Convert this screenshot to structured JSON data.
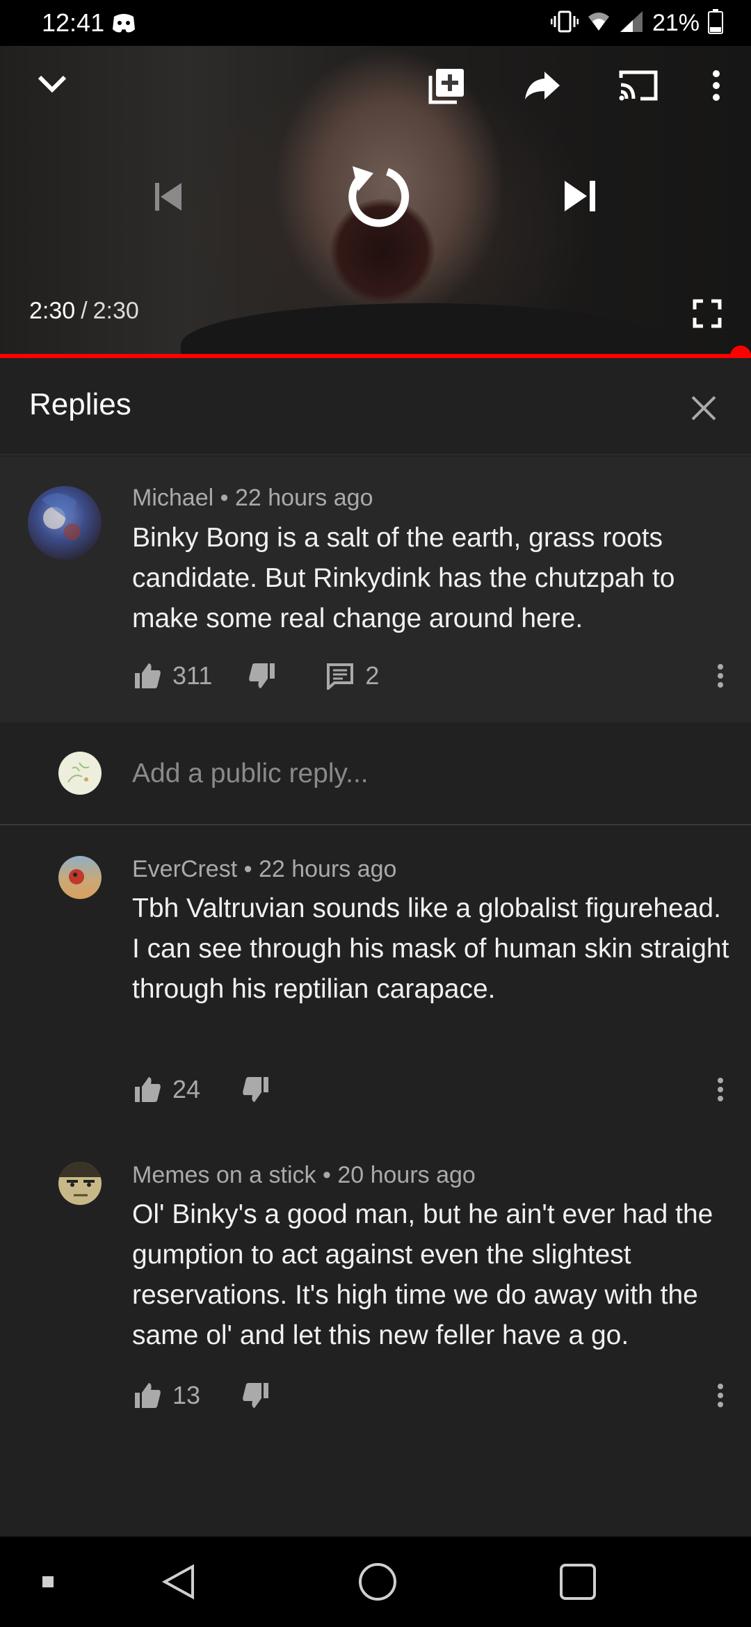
{
  "status_bar": {
    "time": "12:41",
    "battery_percent": "21%",
    "icons": [
      "discord-icon",
      "vibrate-icon",
      "wifi-icon",
      "signal-icon",
      "battery-icon"
    ]
  },
  "player": {
    "current_time": "2:30",
    "separator": "/",
    "duration": "2:30",
    "progress": 1.0,
    "icons": [
      "chevron-down-icon",
      "add-to-playlist-icon",
      "share-icon",
      "cast-icon",
      "more-vert-icon",
      "previous-icon",
      "replay-icon",
      "next-icon",
      "fullscreen-icon"
    ],
    "accent_color": "#ff0000"
  },
  "replies": {
    "title": "Replies"
  },
  "parent_comment": {
    "author": "Michael",
    "time": "22 hours ago",
    "text": "Binky Bong is a salt of the earth, grass roots candidate. But Rinkydink has the chutzpah to make some real change around here.",
    "likes": "311",
    "replies_count": "2"
  },
  "reply_box": {
    "placeholder": "Add a public reply..."
  },
  "comments": [
    {
      "author": "EverCrest",
      "time": "22 hours ago",
      "text": "Tbh Valtruvian sounds like a globalist figurehead. I can see through his mask of human skin straight through his reptilian carapace.",
      "likes": "24"
    },
    {
      "author": "Memes on a stick",
      "time": "20 hours ago",
      "text": "Ol' Binky's a good man, but he ain't ever had the gumption to act against even the slightest reservations. It's high time we do away with the same ol' and let this new feller have a go.",
      "likes": "13"
    }
  ],
  "meta_separator": "•",
  "nav_bar": {
    "icons": [
      "recents-dot-icon",
      "back-icon",
      "home-icon",
      "overview-icon"
    ]
  }
}
